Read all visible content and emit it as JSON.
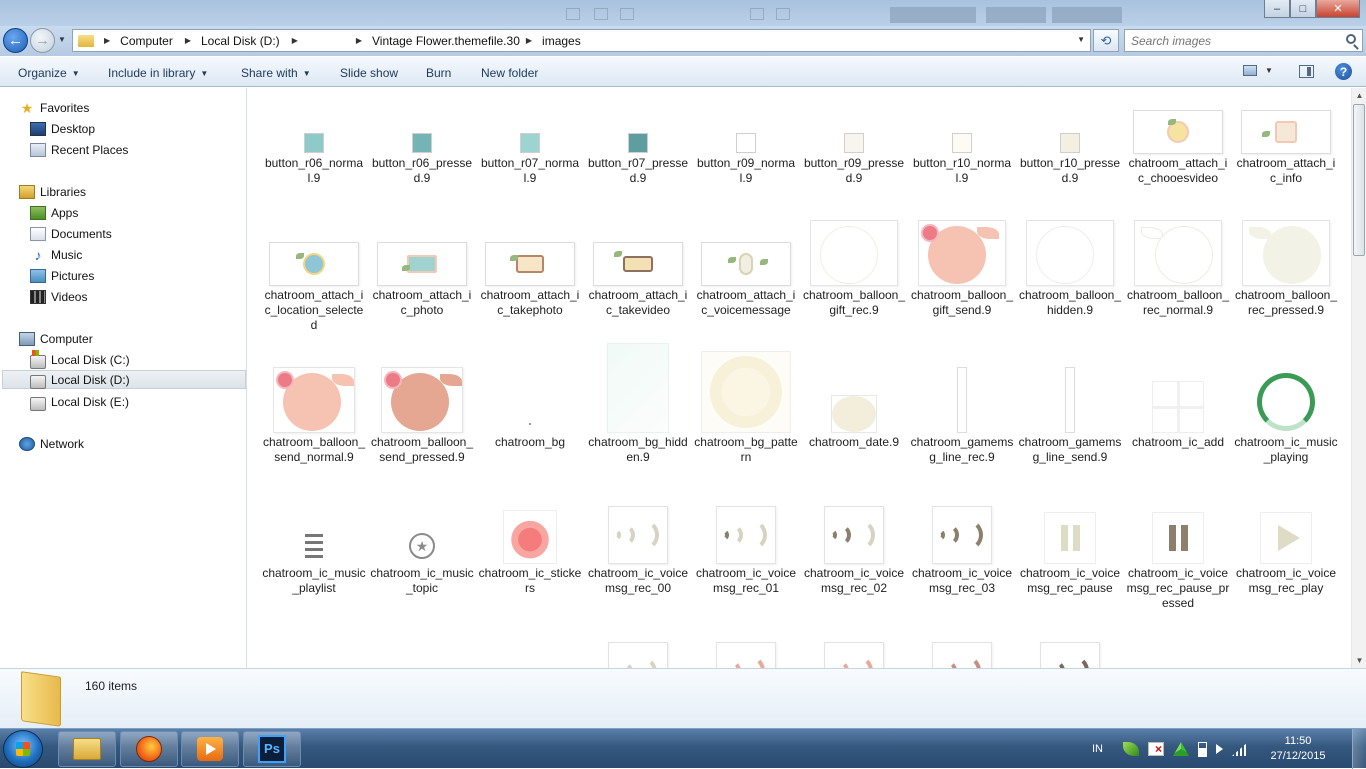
{
  "window": {
    "minimize_glyph": "–",
    "maximize_glyph": "□",
    "close_glyph": "✕"
  },
  "address_bar": {
    "breadcrumbs": [
      "Computer",
      "Local Disk (D:)",
      "",
      "Vintage Flower.themefile.30",
      "images"
    ],
    "search_placeholder": "Search images"
  },
  "command_bar": {
    "organize": "Organize",
    "include_in_library": "Include in library",
    "share_with": "Share with",
    "slide_show": "Slide show",
    "burn": "Burn",
    "new_folder": "New folder"
  },
  "nav": {
    "favorites": "Favorites",
    "desktop": "Desktop",
    "recent_places": "Recent Places",
    "libraries": "Libraries",
    "apps": "Apps",
    "documents": "Documents",
    "music": "Music",
    "pictures": "Pictures",
    "videos": "Videos",
    "computer": "Computer",
    "disk_c": "Local Disk (C:)",
    "disk_d": "Local Disk (D:)",
    "disk_e": "Local Disk (E:)",
    "network": "Network"
  },
  "files": [
    "button_r06_normal.9",
    "button_r06_pressed.9",
    "button_r07_normal.9",
    "button_r07_pressed.9",
    "button_r09_normal.9",
    "button_r09_pressed.9",
    "button_r10_normal.9",
    "button_r10_pressed.9",
    "chatroom_attach_ic_chooesvideo",
    "chatroom_attach_ic_info",
    "chatroom_attach_ic_location_selected",
    "chatroom_attach_ic_photo",
    "chatroom_attach_ic_takephoto",
    "chatroom_attach_ic_takevideo",
    "chatroom_attach_ic_voicemessage",
    "chatroom_balloon_gift_rec.9",
    "chatroom_balloon_gift_send.9",
    "chatroom_balloon_hidden.9",
    "chatroom_balloon_rec_normal.9",
    "chatroom_balloon_rec_pressed.9",
    "chatroom_balloon_send_normal.9",
    "chatroom_balloon_send_pressed.9",
    "chatroom_bg",
    "chatroom_bg_hidden.9",
    "chatroom_bg_pattern",
    "chatroom_date.9",
    "chatroom_gamemsg_line_rec.9",
    "chatroom_gamemsg_line_send.9",
    "chatroom_ic_add",
    "chatroom_ic_music_playing",
    "chatroom_ic_music_playlist",
    "chatroom_ic_music_topic",
    "chatroom_ic_stickers",
    "chatroom_ic_voicemsg_rec_00",
    "chatroom_ic_voicemsg_rec_01",
    "chatroom_ic_voicemsg_rec_02",
    "chatroom_ic_voicemsg_rec_03",
    "chatroom_ic_voicemsg_rec_pause",
    "chatroom_ic_voicemsg_rec_pause_pressed",
    "chatroom_ic_voicemsg_rec_play"
  ],
  "colors": {
    "r06_normal": "#8fcaca",
    "r06_pressed": "#74b3b6",
    "r07_normal": "#9dd3d1",
    "r07_pressed": "#5f9ea0",
    "r09_normal": "#ffffff",
    "r09_pressed": "#f8f5ee",
    "r10_normal": "#fcfbf4",
    "r10_pressed": "#f3f0e2",
    "balloon_send_normal": "#f6c2b1",
    "balloon_send_pressed": "#e5a791",
    "balloon_rec_pressed": "#f3f2e6"
  },
  "status": {
    "item_count": "160 items"
  },
  "taskbar": {
    "photoshop_label": "Ps",
    "language": "IN",
    "time": "11:50",
    "date": "27/12/2015"
  }
}
